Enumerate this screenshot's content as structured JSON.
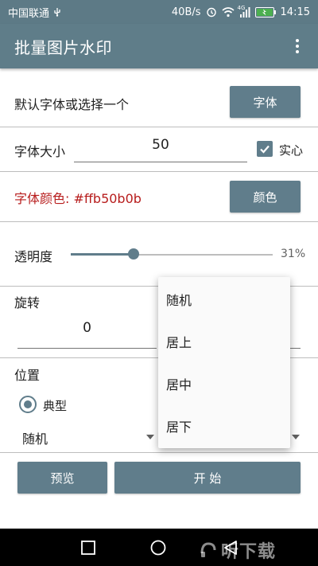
{
  "status_bar": {
    "carrier": "中国联通",
    "net_speed": "40B/s",
    "network_type": "4G",
    "time": "14:15"
  },
  "app_bar": {
    "title": "批量图片水印"
  },
  "font_select": {
    "label": "默认字体或选择一个",
    "button": "字体"
  },
  "font_size": {
    "label": "字体大小",
    "value": "50",
    "solid_label": "实心",
    "solid_checked": true
  },
  "font_color": {
    "label": "字体颜色: #ffb50b0b",
    "color": "#b71c1c",
    "button": "颜色"
  },
  "opacity": {
    "label": "透明度",
    "value_text": "31%",
    "value": 0.31
  },
  "rotation": {
    "label": "旋转",
    "value": "0"
  },
  "position": {
    "label": "位置",
    "radio_label": "典型",
    "spinner_value": "随机"
  },
  "popup_menu": {
    "items": [
      "随机",
      "居上",
      "居中",
      "居下"
    ]
  },
  "actions": {
    "preview": "预览",
    "start": "开 始"
  },
  "nav": {
    "icons": [
      "recent-apps-icon",
      "home-icon",
      "back-icon"
    ]
  },
  "watermark": {
    "text": "听下载"
  },
  "colors": {
    "primary": "#607d8b",
    "appbar": "#5f7d89",
    "accent_text": "#b71c1c"
  }
}
